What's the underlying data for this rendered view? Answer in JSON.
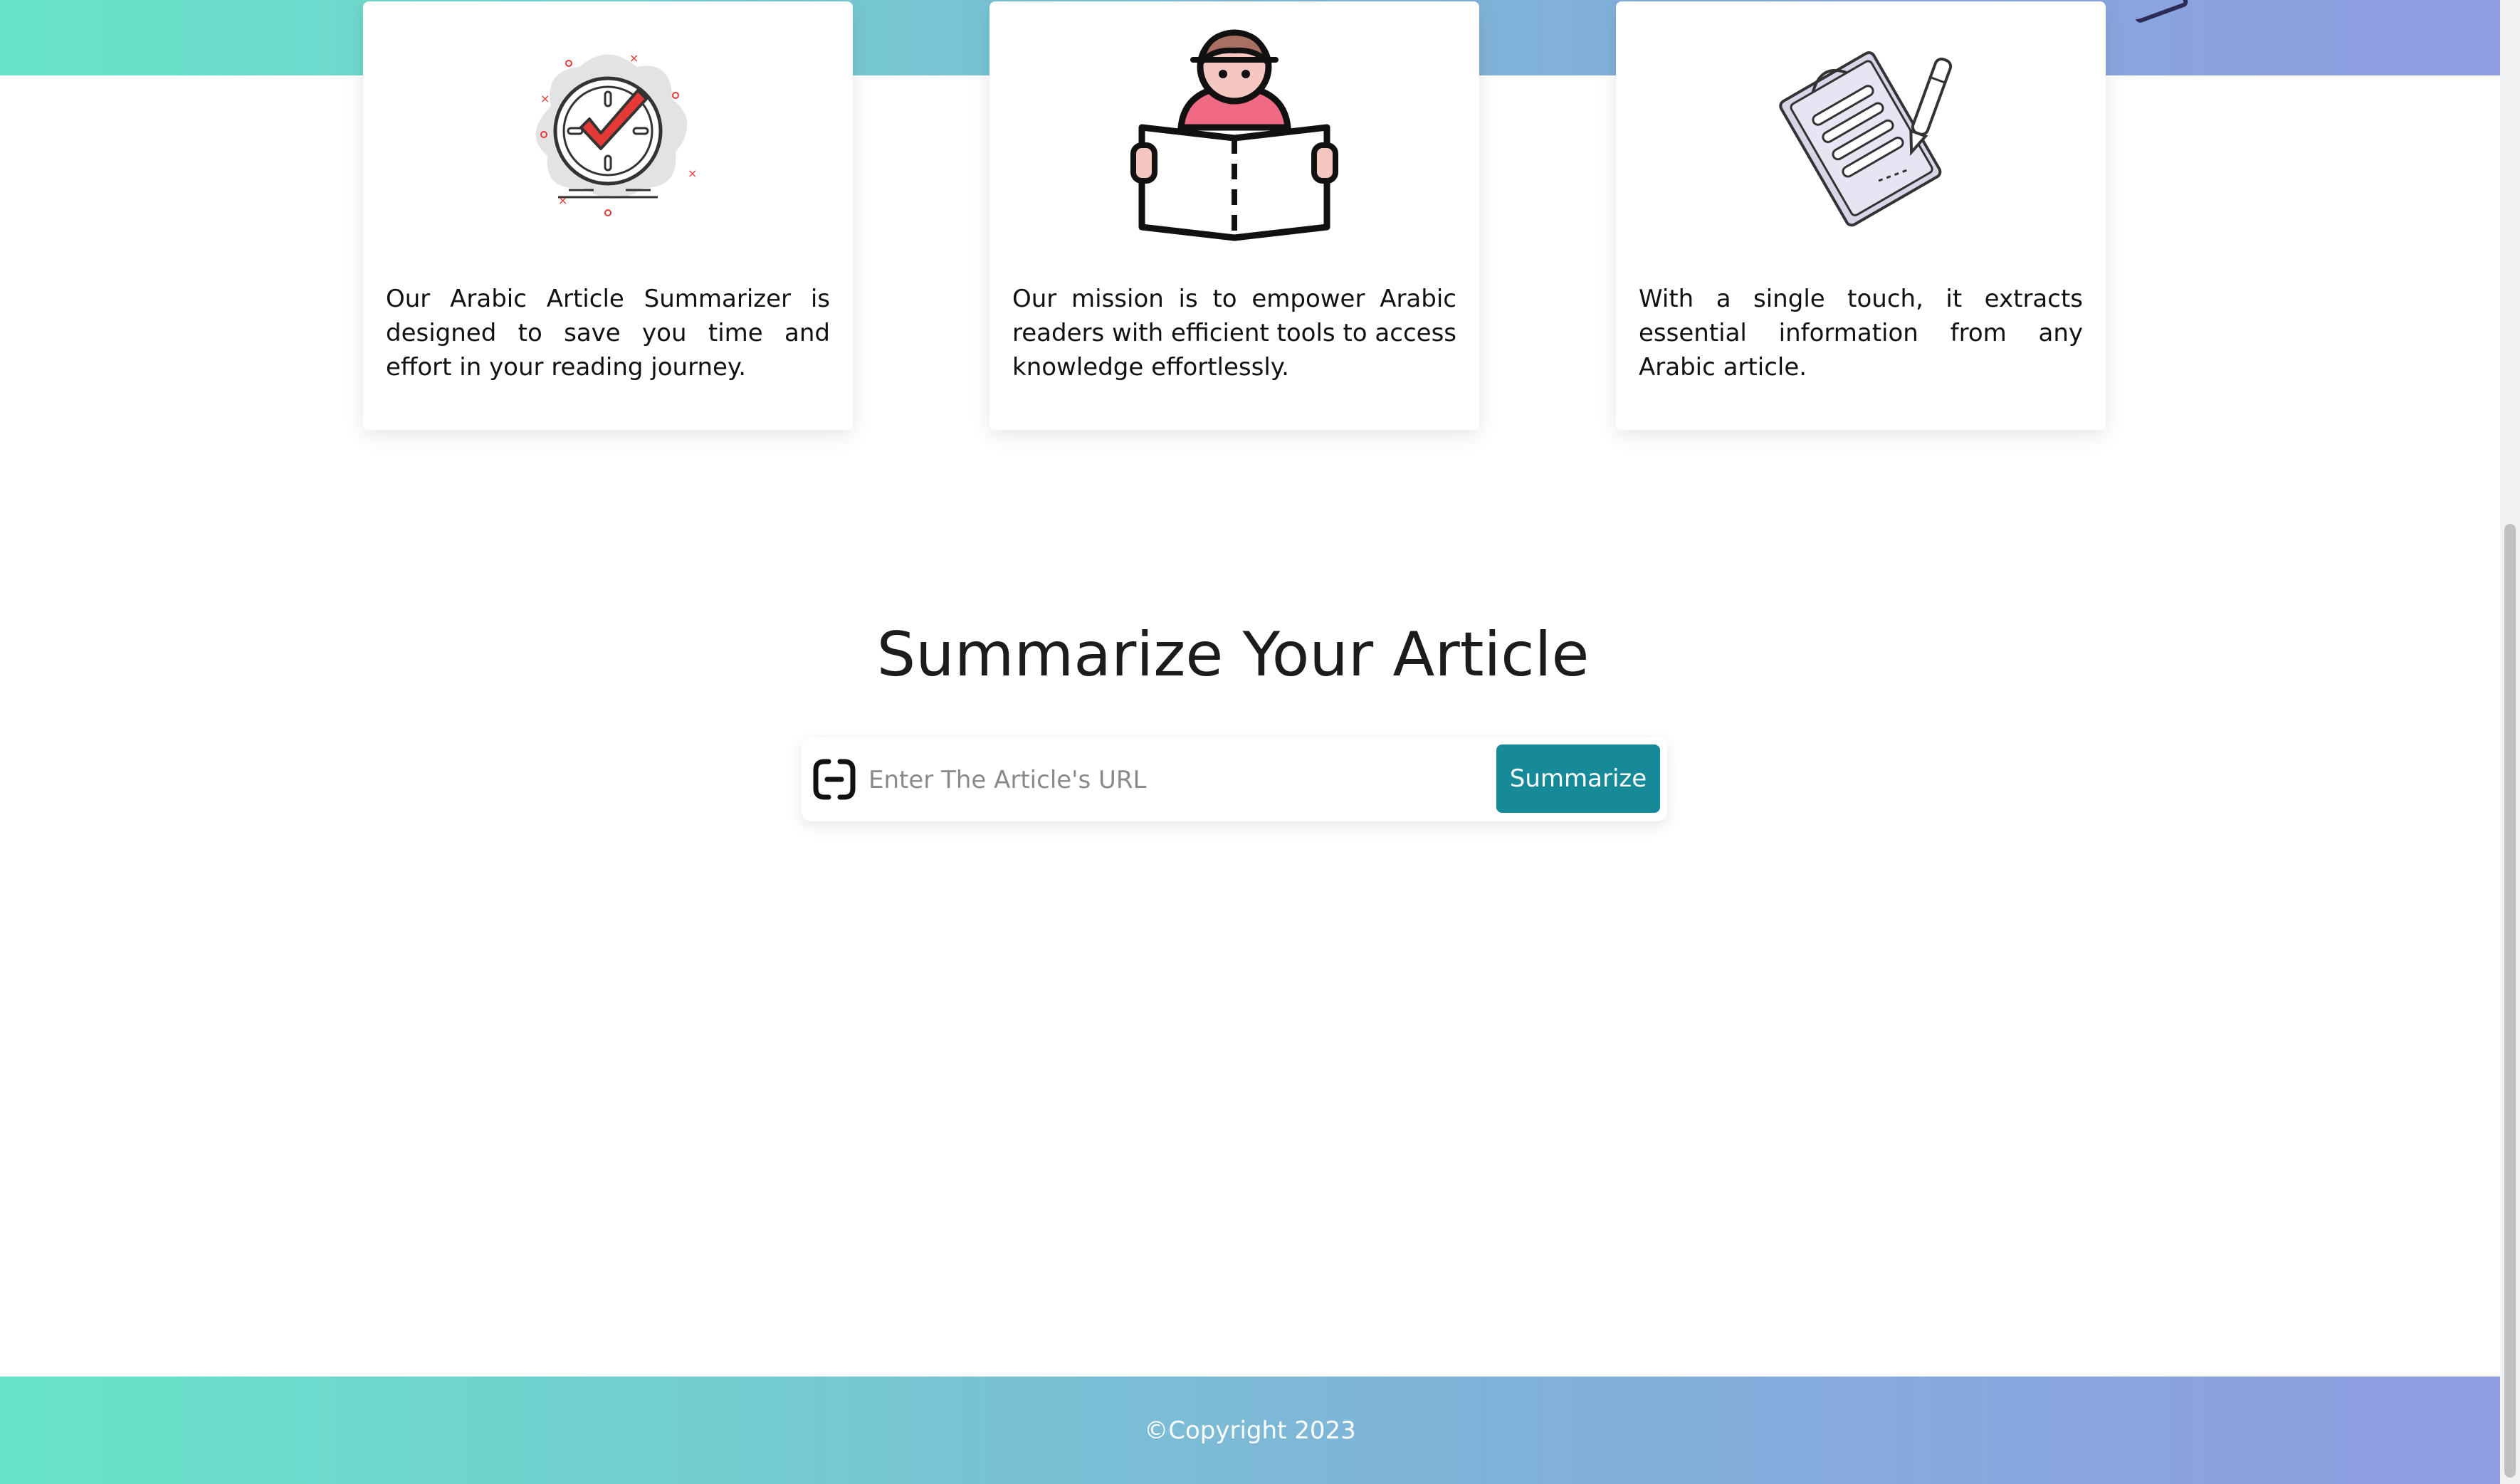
{
  "features": {
    "cards": [
      {
        "text": "Our Arabic Article Summarizer is designed to save you time and effort in your reading journey."
      },
      {
        "text": "Our mission is to empower Arabic readers with efficient tools to access knowledge effortlessly."
      },
      {
        "text": "With a single touch, it extracts essential information from any Arabic article."
      }
    ]
  },
  "summarize": {
    "title": "Summarize Your Article",
    "input_placeholder": "Enter The Article's URL",
    "button_label": "Summarize"
  },
  "footer": {
    "copyright": "©Copyright 2023"
  },
  "colors": {
    "gradient_start": "#67e5c8",
    "gradient_end": "#8f9ce2",
    "button": "#168a99",
    "accent_red": "#e53935",
    "reader_pink": "#f06a84"
  },
  "icons": [
    "clock-check-icon",
    "reader-icon",
    "document-pen-icon",
    "link-icon"
  ]
}
